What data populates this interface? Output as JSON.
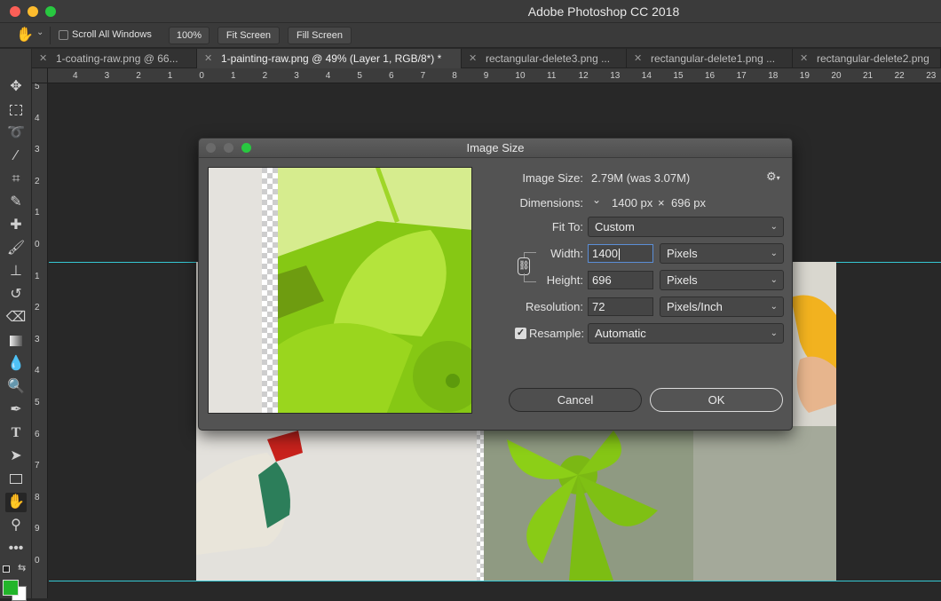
{
  "app": {
    "title": "Adobe Photoshop CC 2018"
  },
  "options_bar": {
    "scroll_all_windows_label": "Scroll All Windows",
    "scroll_all_windows_checked": false,
    "zoom_100_label": "100%",
    "fit_screen_label": "Fit Screen",
    "fill_screen_label": "Fill Screen"
  },
  "tabs": [
    {
      "label": "1-coating-raw.png @ 66...",
      "active": false
    },
    {
      "label": "1-painting-raw.png @ 49% (Layer 1, RGB/8*) *",
      "active": true
    },
    {
      "label": "rectangular-delete3.png ...",
      "active": false
    },
    {
      "label": "rectangular-delete1.png ...",
      "active": false
    },
    {
      "label": "rectangular-delete2.png",
      "active": false
    }
  ],
  "ruler_top": [
    "4",
    "3",
    "2",
    "1",
    "0",
    "1",
    "2",
    "3",
    "4",
    "5",
    "6",
    "7",
    "8",
    "9",
    "10",
    "11",
    "12",
    "13",
    "14",
    "15",
    "16",
    "17",
    "18",
    "19",
    "20",
    "21",
    "22",
    "23"
  ],
  "ruler_left": [
    "5",
    "4",
    "3",
    "2",
    "1",
    "0",
    "1",
    "2",
    "3",
    "4",
    "5",
    "6",
    "7",
    "8",
    "9",
    "0"
  ],
  "colors": {
    "foreground": "#22b52a",
    "background": "#ffffff",
    "guide": "#35c8d4"
  },
  "dialog": {
    "title": "Image Size",
    "image_size_label": "Image Size:",
    "image_size_value": "2.79M (was 3.07M)",
    "dimensions_label": "Dimensions:",
    "dimensions_width": "1400 px",
    "dimensions_times": "×",
    "dimensions_height": "696 px",
    "fit_to_label": "Fit To:",
    "fit_to_value": "Custom",
    "width_label": "Width:",
    "width_value": "1400",
    "width_unit": "Pixels",
    "height_label": "Height:",
    "height_value": "696",
    "height_unit": "Pixels",
    "resolution_label": "Resolution:",
    "resolution_value": "72",
    "resolution_unit": "Pixels/Inch",
    "resample_label": "Resample:",
    "resample_checked": true,
    "resample_value": "Automatic",
    "cancel_label": "Cancel",
    "ok_label": "OK"
  }
}
